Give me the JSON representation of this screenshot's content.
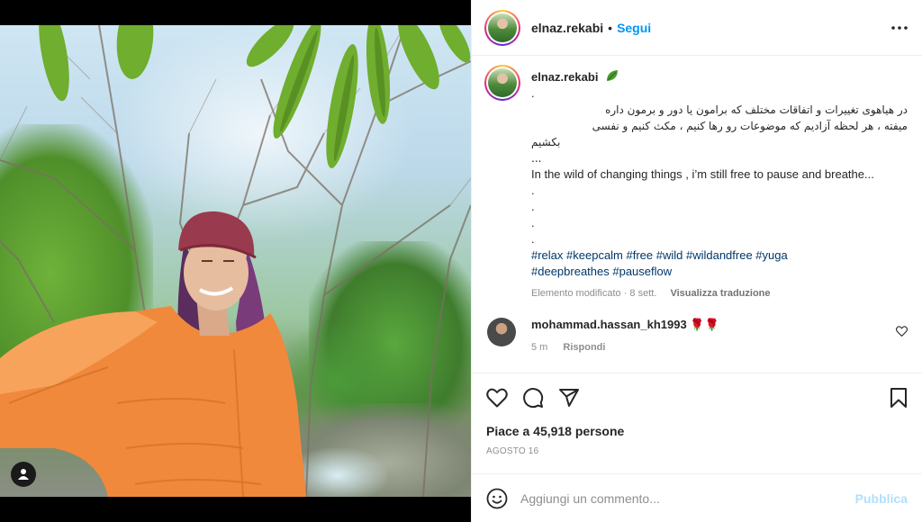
{
  "post": {
    "username": "elnaz.rekabi",
    "follow_label": "Segui",
    "separator": "•",
    "caption": {
      "username": "elnaz.rekabi",
      "dot1": ".",
      "farsi_line1": "در هیاهوی تغییرات و اتفاقات مختلف که برامون یا دور و برمون داره",
      "farsi_line2": "میفته ، هر لحظه آزادیم که موضوعات رو رها کنیم ، مکث کنیم و نفسی",
      "farsi_line3": "بکشیم ...",
      "english": "In the wild of changing things , i’m still free to pause and breathe...",
      "dots": [
        ".",
        ".",
        ".",
        "."
      ],
      "hashtags_line1": "#relax #keepcalm #free #wild #wildandfree #yuga",
      "hashtags_line2": "#deepbreathes #pauseflow",
      "edited": "Elemento modificato · 8 sett.",
      "translate": "Visualizza traduzione"
    },
    "comment": {
      "username": "mohammad.hassan_kh1993",
      "text": "🌹🌹",
      "time": "5 m",
      "reply": "Rispondi"
    },
    "likes": "Piace a 45,918 persone",
    "date": "AGOSTO 16",
    "add_comment": {
      "placeholder": "Aggiungi un commento...",
      "publish": "Pubblica"
    }
  },
  "icons": {
    "more": "more-icon",
    "like": "heart-icon",
    "comment": "comment-icon",
    "share": "share-icon",
    "save": "bookmark-icon",
    "emoji": "emoji-icon",
    "user_tag": "user-tag-icon",
    "leaf": "leaf-icon"
  },
  "colors": {
    "accent": "#0095f6",
    "publish_disabled": "#b2dffc",
    "hashtag": "#00376b",
    "muted": "#8e8e8e"
  }
}
